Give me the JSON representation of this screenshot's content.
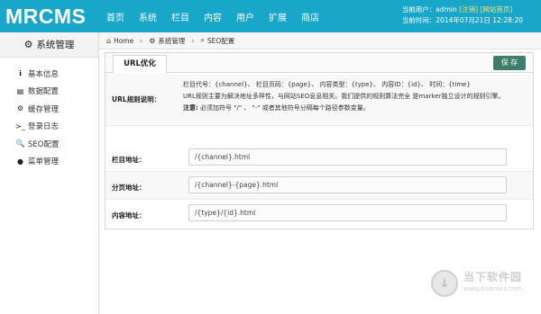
{
  "header": {
    "logo": "MRCMS",
    "nav": [
      "首页",
      "系统",
      "栏目",
      "内容",
      "用户",
      "扩展",
      "商店"
    ],
    "user_label": "当前用户：admin",
    "logout": "[注销]",
    "site_home": "[网站首页]",
    "time": "当前时间：2014年07月21日 12:28:20"
  },
  "sidebar": {
    "title": "系统管理",
    "items": [
      {
        "icon": "info-icon",
        "glyph": "ℹ",
        "label": "基本信息"
      },
      {
        "icon": "data-icon",
        "glyph": "▤",
        "label": "数据配置"
      },
      {
        "icon": "cache-icon",
        "glyph": "⚙",
        "label": "缓存管理"
      },
      {
        "icon": "terminal-icon",
        "glyph": ">_",
        "label": "登录日志"
      },
      {
        "icon": "search-icon",
        "glyph": "🔍",
        "label": "SEO配置"
      },
      {
        "icon": "circle-icon",
        "glyph": "●",
        "label": "菜单管理"
      }
    ]
  },
  "breadcrumb": {
    "home": "Home",
    "section": "系统管理",
    "current": "SEO配置"
  },
  "panel": {
    "tab": "URL优化",
    "save": "保 存",
    "rule_label": "URL规则说明：",
    "rule_line1": "栏目代号：{channel}、 栏目页码：{page}、 内容类型：{type}、 内容ID：{id}、 时间：{time}",
    "rule_line2": "URL规则主要为解决地址多样性，与网站SEO息息相关。我们提供的规则算法完全 是marker独立设计的规则引擎。",
    "note_label": "注意:",
    "note_text": " 必须加符号 \"/\"  、 \"-\" 或者其他符号分隔每个路径参数变量。",
    "fields": [
      {
        "label": "栏目地址：",
        "value": "/{channel}.html"
      },
      {
        "label": "分页地址：",
        "value": "/{channel}-{page}.html"
      },
      {
        "label": "内容地址：",
        "value": "/{type}/{id}.html"
      }
    ]
  },
  "watermark": {
    "cn": "当下软件园",
    "en": "www.downxia.com"
  },
  "colors": {
    "header_bg": "#18a6c9",
    "save_button": "#3f7d6d",
    "link_yellow": "#ffe066"
  }
}
